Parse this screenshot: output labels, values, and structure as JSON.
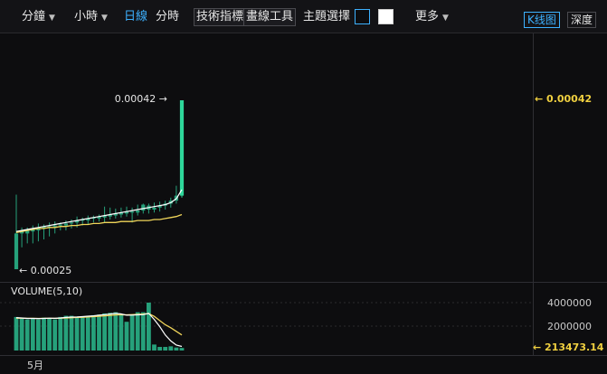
{
  "toolbar": {
    "minutes_label": "分鐘",
    "hours_label": "小時",
    "daily_label": "日線",
    "timeshare_label": "分時",
    "indicators_label": "技術指標",
    "drawing_tools_label": "畫線工具",
    "theme_label": "主題選擇",
    "more_label": "更多",
    "kline_label": "K线图",
    "depth_label": "深度",
    "theme_colors": {
      "dark": "#0d0d0f",
      "light": "#ffffff"
    },
    "caret_icon": "chevron-down-icon"
  },
  "main_chart": {
    "high_annotation": "0.00042 →",
    "low_annotation": "← 0.00025",
    "last_price_label": "← 0.00042",
    "colors": {
      "up": "#26a17b",
      "up_bright": "#2ed79a",
      "ma_fast": "#ffffff",
      "ma_slow": "#f0d55a",
      "price_label": "#f0d040"
    }
  },
  "volume_panel": {
    "title": "VOLUME(5,10)",
    "axis_labels": [
      "4000000",
      "2000000"
    ],
    "last_value_label": "← 213473.14"
  },
  "time_axis": {
    "labels": [
      "5月"
    ]
  },
  "chart_data": [
    {
      "type": "candlestick",
      "ylim": [
        0.00025,
        0.00042
      ],
      "annotations": [
        "0.00042",
        "0.00025"
      ],
      "candles": [
        {
          "o": 0.00025,
          "h": 0.000325,
          "l": 0.00025,
          "c": 0.000286
        },
        {
          "o": 0.000286,
          "h": 0.000292,
          "l": 0.000272,
          "c": 0.000288
        },
        {
          "o": 0.000286,
          "h": 0.000292,
          "l": 0.000276,
          "c": 0.000289
        },
        {
          "o": 0.000288,
          "h": 0.000294,
          "l": 0.000276,
          "c": 0.00029
        },
        {
          "o": 0.000289,
          "h": 0.000296,
          "l": 0.000278,
          "c": 0.000292
        },
        {
          "o": 0.000291,
          "h": 0.000295,
          "l": 0.00028,
          "c": 0.000293
        },
        {
          "o": 0.000292,
          "h": 0.000297,
          "l": 0.000283,
          "c": 0.000293
        },
        {
          "o": 0.000293,
          "h": 0.000298,
          "l": 0.000286,
          "c": 0.000294
        },
        {
          "o": 0.000294,
          "h": 0.000297,
          "l": 0.000289,
          "c": 0.000295
        },
        {
          "o": 0.000294,
          "h": 0.000299,
          "l": 0.000289,
          "c": 0.000296
        },
        {
          "o": 0.000296,
          "h": 0.0003,
          "l": 0.000291,
          "c": 0.000297
        },
        {
          "o": 0.000297,
          "h": 0.000303,
          "l": 0.000292,
          "c": 0.000299
        },
        {
          "o": 0.000299,
          "h": 0.000302,
          "l": 0.000294,
          "c": 0.0003
        },
        {
          "o": 0.000299,
          "h": 0.000304,
          "l": 0.000295,
          "c": 0.000301
        },
        {
          "o": 0.000301,
          "h": 0.000304,
          "l": 0.000297,
          "c": 0.000302
        },
        {
          "o": 0.000301,
          "h": 0.000305,
          "l": 0.000298,
          "c": 0.000303
        },
        {
          "o": 0.000302,
          "h": 0.000313,
          "l": 0.000297,
          "c": 0.000304
        },
        {
          "o": 0.000303,
          "h": 0.000312,
          "l": 0.0003,
          "c": 0.000305
        },
        {
          "o": 0.000304,
          "h": 0.000311,
          "l": 0.000301,
          "c": 0.000306
        },
        {
          "o": 0.000305,
          "h": 0.000312,
          "l": 0.000302,
          "c": 0.000307
        },
        {
          "o": 0.000306,
          "h": 0.000313,
          "l": 0.000303,
          "c": 0.000308
        },
        {
          "o": 0.000307,
          "h": 0.000312,
          "l": 0.000297,
          "c": 0.000308
        },
        {
          "o": 0.000307,
          "h": 0.000315,
          "l": 0.000304,
          "c": 0.000309
        },
        {
          "o": 0.000309,
          "h": 0.000316,
          "l": 0.000306,
          "c": 0.000315
        },
        {
          "o": 0.000314,
          "h": 0.000316,
          "l": 0.000306,
          "c": 0.00031
        },
        {
          "o": 0.00031,
          "h": 0.000317,
          "l": 0.000307,
          "c": 0.000312
        },
        {
          "o": 0.000312,
          "h": 0.000318,
          "l": 0.000308,
          "c": 0.000314
        },
        {
          "o": 0.000314,
          "h": 0.000319,
          "l": 0.00031,
          "c": 0.000316
        },
        {
          "o": 0.000316,
          "h": 0.000322,
          "l": 0.000312,
          "c": 0.000319
        },
        {
          "o": 0.000319,
          "h": 0.000334,
          "l": 0.000316,
          "c": 0.000324
        },
        {
          "o": 0.000324,
          "h": 0.00042,
          "l": 0.000322,
          "c": 0.00042
        }
      ],
      "ma_fast": [
        0.000288,
        0.000289,
        0.00029,
        0.000291,
        0.000292,
        0.000293,
        0.000294,
        0.000295,
        0.000296,
        0.000297,
        0.000298,
        0.000299,
        0.0003,
        0.000301,
        0.000302,
        0.000303,
        0.000304,
        0.000305,
        0.000306,
        0.000307,
        0.000308,
        0.000309,
        0.00031,
        0.000311,
        0.000312,
        0.000313,
        0.000314,
        0.000315,
        0.000317,
        0.000321,
        0.00033
      ],
      "ma_slow": [
        0.000287,
        0.000288,
        0.000289,
        0.00029,
        0.000291,
        0.000291,
        0.000292,
        0.000292,
        0.000293,
        0.000293,
        0.000294,
        0.000294,
        0.000295,
        0.000295,
        0.000296,
        0.000296,
        0.000297,
        0.000297,
        0.000297,
        0.000298,
        0.000298,
        0.000298,
        0.000299,
        0.000299,
        0.000299,
        0.0003,
        0.0003,
        0.000301,
        0.000302,
        0.000303,
        0.000305
      ]
    },
    {
      "type": "bar",
      "title": "VOLUME(5,10)",
      "ylim": [
        0,
        5000000
      ],
      "values": [
        2800000,
        2700000,
        2600000,
        2700000,
        2600000,
        2750000,
        2700000,
        2600000,
        2800000,
        2900000,
        2900000,
        2800000,
        2850000,
        2900000,
        2950000,
        3000000,
        3100000,
        3150000,
        3200000,
        3000000,
        2400000,
        3000000,
        3200000,
        3200000,
        4000000,
        500000,
        300000,
        300000,
        350000,
        250000,
        213473
      ],
      "ma5": [
        2750000,
        2720000,
        2680000,
        2680000,
        2670000,
        2680000,
        2700000,
        2690000,
        2720000,
        2760000,
        2790000,
        2800000,
        2830000,
        2870000,
        2900000,
        2950000,
        3000000,
        3050000,
        3100000,
        3060000,
        2950000,
        2960000,
        2980000,
        3000000,
        3100000,
        2600000,
        2000000,
        1300000,
        800000,
        450000,
        340000
      ],
      "ma10": [
        2700000,
        2700000,
        2690000,
        2690000,
        2680000,
        2690000,
        2690000,
        2690000,
        2700000,
        2720000,
        2740000,
        2760000,
        2780000,
        2800000,
        2830000,
        2860000,
        2900000,
        2930000,
        2970000,
        3000000,
        2980000,
        3000000,
        3020000,
        3040000,
        3080000,
        2850000,
        2500000,
        2150000,
        1900000,
        1600000,
        1300000
      ]
    }
  ]
}
